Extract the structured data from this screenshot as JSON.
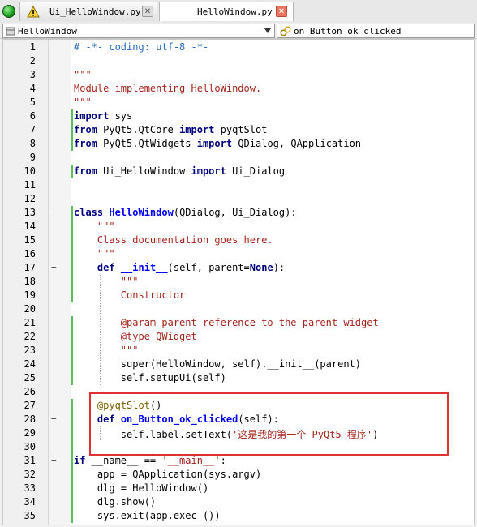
{
  "tabs": [
    {
      "label": "Ui_HelloWindow.py",
      "has_warning": true
    },
    {
      "label": "HelloWindow.py",
      "active": true
    }
  ],
  "toolbar": {
    "class_combo": "HelloWindow",
    "method_combo": "on_Button_ok_clicked"
  },
  "editor": {
    "lines": [
      {
        "n": "1",
        "text": "# -*- coding: utf-8 -*-"
      },
      {
        "n": "2",
        "text": ""
      },
      {
        "n": "3",
        "text": "\"\"\""
      },
      {
        "n": "4",
        "text": "Module implementing HelloWindow."
      },
      {
        "n": "5",
        "text": "\"\"\""
      },
      {
        "n": "6",
        "text": "import sys"
      },
      {
        "n": "7",
        "text": "from PyQt5.QtCore import pyqtSlot"
      },
      {
        "n": "8",
        "text": "from PyQt5.QtWidgets import QDialog, QApplication"
      },
      {
        "n": "9",
        "text": ""
      },
      {
        "n": "10",
        "text": "from Ui_HelloWindow import Ui_Dialog"
      },
      {
        "n": "11",
        "text": ""
      },
      {
        "n": "12",
        "text": ""
      },
      {
        "n": "13",
        "text": "class HelloWindow(QDialog, Ui_Dialog):"
      },
      {
        "n": "14",
        "text": "    \"\"\""
      },
      {
        "n": "15",
        "text": "    Class documentation goes here."
      },
      {
        "n": "16",
        "text": "    \"\"\""
      },
      {
        "n": "17",
        "text": "    def __init__(self, parent=None):"
      },
      {
        "n": "18",
        "text": "        \"\"\""
      },
      {
        "n": "19",
        "text": "        Constructor"
      },
      {
        "n": "20",
        "text": ""
      },
      {
        "n": "21",
        "text": "        @param parent reference to the parent widget"
      },
      {
        "n": "22",
        "text": "        @type QWidget"
      },
      {
        "n": "23",
        "text": "        \"\"\""
      },
      {
        "n": "24",
        "text": "        super(HelloWindow, self).__init__(parent)"
      },
      {
        "n": "25",
        "text": "        self.setupUi(self)"
      },
      {
        "n": "26",
        "text": ""
      },
      {
        "n": "27",
        "text": "    @pyqtSlot()"
      },
      {
        "n": "28",
        "text": "    def on_Button_ok_clicked(self):"
      },
      {
        "n": "29",
        "text": "        self.label.setText('这是我的第一个 PyQt5 程序')"
      },
      {
        "n": "30",
        "text": ""
      },
      {
        "n": "31",
        "text": "if __name__ == '__main__':"
      },
      {
        "n": "32",
        "text": "    app = QApplication(sys.argv)"
      },
      {
        "n": "33",
        "text": "    dlg = HelloWindow()"
      },
      {
        "n": "34",
        "text": "    dlg.show()"
      },
      {
        "n": "35",
        "text": "    sys.exit(app.exec_())"
      }
    ]
  }
}
